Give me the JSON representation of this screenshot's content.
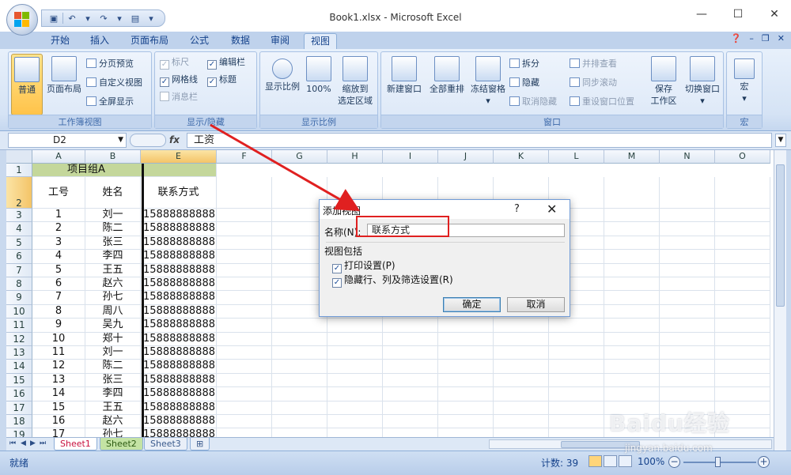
{
  "window": {
    "title": "Book1.xlsx - Microsoft Excel",
    "min": "—",
    "max": "☐",
    "close": "✕"
  },
  "tabs": [
    "开始",
    "插入",
    "页面布局",
    "公式",
    "数据",
    "审阅",
    "视图"
  ],
  "active_tab": "视图",
  "ribbon": {
    "workbook_views": {
      "label": "工作簿视图",
      "normal": "普通",
      "page_layout": "页面布局",
      "page_break": "分页预览",
      "custom_views": "自定义视图",
      "full_screen": "全屏显示"
    },
    "show_hide": {
      "label": "显示/隐藏",
      "ruler": "标尺",
      "formula_bar": "编辑栏",
      "gridlines": "网格线",
      "headings": "标题",
      "message_bar": "消息栏"
    },
    "zoom": {
      "label": "显示比例",
      "zoom": "显示比例",
      "hundred": "100%",
      "zoom_sel_1": "缩放到",
      "zoom_sel_2": "选定区域"
    },
    "window": {
      "label": "窗口",
      "new_window": "新建窗口",
      "arrange_all": "全部重排",
      "freeze": "冻结窗格",
      "split": "拆分",
      "hide": "隐藏",
      "unhide": "取消隐藏",
      "side_by_side": "并排查看",
      "sync_scroll": "同步滚动",
      "reset_pos": "重设窗口位置",
      "save_ws_1": "保存",
      "save_ws_2": "工作区",
      "switch": "切换窗口"
    },
    "macros": {
      "label": "宏",
      "macros": "宏"
    }
  },
  "formula_bar": {
    "cell_ref": "D2",
    "fx": "fx",
    "content": "工资"
  },
  "grid": {
    "columns": [
      "A",
      "B",
      "E",
      "F",
      "G",
      "H",
      "I",
      "J",
      "K",
      "L",
      "M",
      "N",
      "O"
    ],
    "merged_title": "项目组A",
    "header_row": [
      "工号",
      "姓名",
      "联系方式"
    ],
    "rows": [
      {
        "n": "3",
        "id": "1",
        "name": "刘一",
        "phone": "15888888888"
      },
      {
        "n": "4",
        "id": "2",
        "name": "陈二",
        "phone": "15888888888"
      },
      {
        "n": "5",
        "id": "3",
        "name": "张三",
        "phone": "15888888888"
      },
      {
        "n": "6",
        "id": "4",
        "name": "李四",
        "phone": "15888888888"
      },
      {
        "n": "7",
        "id": "5",
        "name": "王五",
        "phone": "15888888888"
      },
      {
        "n": "8",
        "id": "6",
        "name": "赵六",
        "phone": "15888888888"
      },
      {
        "n": "9",
        "id": "7",
        "name": "孙七",
        "phone": "15888888888"
      },
      {
        "n": "10",
        "id": "8",
        "name": "周八",
        "phone": "15888888888"
      },
      {
        "n": "11",
        "id": "9",
        "name": "吴九",
        "phone": "15888888888"
      },
      {
        "n": "12",
        "id": "10",
        "name": "郑十",
        "phone": "15888888888"
      },
      {
        "n": "13",
        "id": "11",
        "name": "刘一",
        "phone": "15888888888"
      },
      {
        "n": "14",
        "id": "12",
        "name": "陈二",
        "phone": "15888888888"
      },
      {
        "n": "15",
        "id": "13",
        "name": "张三",
        "phone": "15888888888"
      },
      {
        "n": "16",
        "id": "14",
        "name": "李四",
        "phone": "15888888888"
      },
      {
        "n": "17",
        "id": "15",
        "name": "王五",
        "phone": "15888888888"
      },
      {
        "n": "18",
        "id": "16",
        "name": "赵六",
        "phone": "15888888888"
      },
      {
        "n": "19",
        "id": "17",
        "name": "孙七",
        "phone": "15888888888"
      }
    ]
  },
  "sheets": [
    "Sheet1",
    "Sheet2",
    "Sheet3"
  ],
  "status": {
    "ready": "就绪",
    "count": "计数: 39",
    "zoom": "100%"
  },
  "dialog": {
    "title": "添加视图",
    "help": "?",
    "close": "✕",
    "name_label": "名称(N):",
    "name_value": "联系方式",
    "includes_label": "视图包括",
    "print_settings": "打印设置(P)",
    "hidden_settings": "隐藏行、列及筛选设置(R)",
    "ok": "确定",
    "cancel": "取消"
  },
  "colors": {
    "accent": "#15428b",
    "highlight": "#e02020",
    "header_fill": "#c4d79b"
  },
  "watermark": {
    "brand": "Baidu经验",
    "url": "jingyan.baidu.com"
  }
}
